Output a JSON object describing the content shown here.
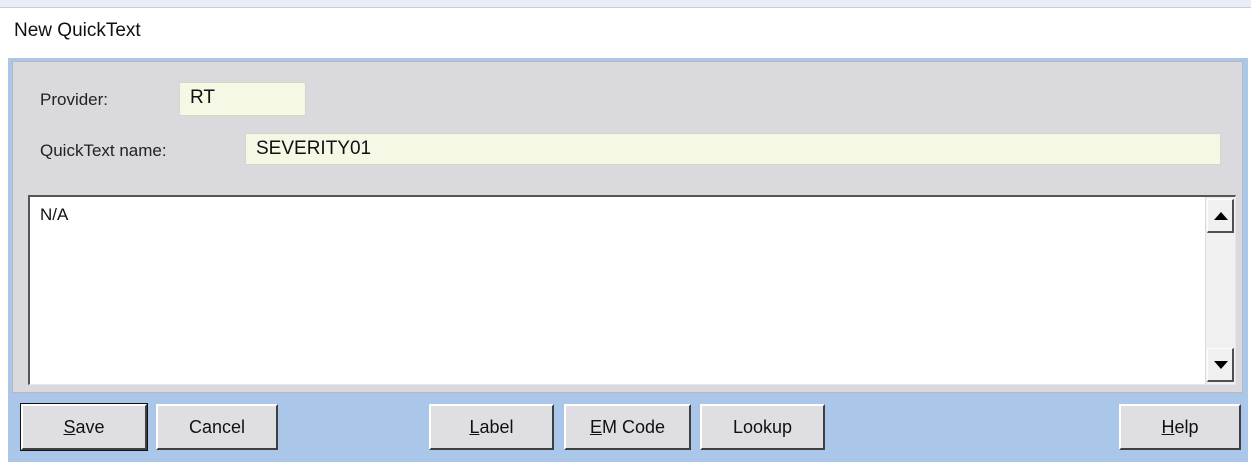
{
  "window": {
    "title": "New QuickText"
  },
  "form": {
    "provider_label": "Provider:",
    "provider_value": "RT",
    "name_label": "QuickText name:",
    "name_value": "SEVERITY01",
    "body_text": "N/A"
  },
  "buttons": {
    "save": {
      "accel": "S",
      "rest": "ave"
    },
    "cancel": {
      "label": "Cancel"
    },
    "label": {
      "accel": "L",
      "rest": "abel"
    },
    "em_code": {
      "accel": "E",
      "rest": "M Code"
    },
    "lookup": {
      "label": "Lookup"
    },
    "help": {
      "accel": "H",
      "rest": "elp"
    }
  },
  "icons": {
    "scroll_up": "arrow-up-icon",
    "scroll_down": "arrow-down-icon"
  },
  "colors": {
    "frame": "#aac6e8",
    "client": "#dad9dd",
    "field_bg": "#f4f8e4"
  }
}
